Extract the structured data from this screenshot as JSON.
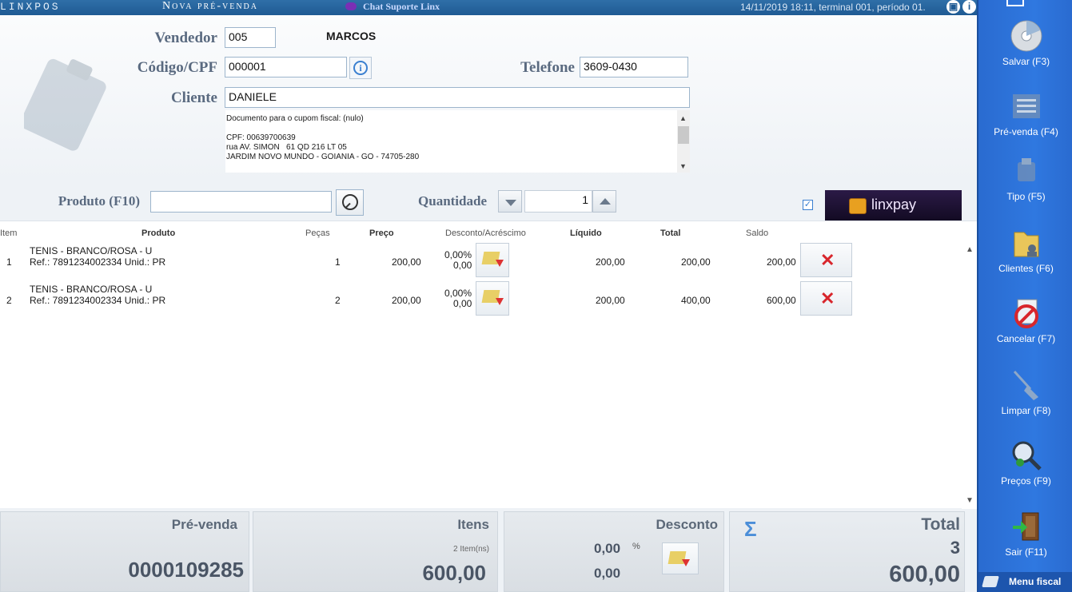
{
  "titlebar": {
    "brand": "LINXPOS",
    "screen": "Nova pré-venda",
    "chat": "Chat Suporte Linx",
    "status": "14/11/2019 18:11, terminal 001, período 01."
  },
  "form": {
    "vendedor_label": "Vendedor",
    "vendedor_code": "005",
    "vendedor_name": "MARCOS",
    "codigo_label": "Código/CPF",
    "codigo_value": "000001",
    "telefone_label": "Telefone",
    "telefone_value": "3609-0430",
    "cliente_label": "Cliente",
    "cliente_value": "DANIELE",
    "doc_lines": [
      "Documento para o cupom fiscal: (nulo)",
      "",
      "CPF: 00639700639",
      "rua AV. SIMON   61 QD 216 LT 05",
      "JARDIM NOVO MUNDO - GOIANIA - GO - 74705-280"
    ]
  },
  "product_bar": {
    "produto_label": "Produto (F10)",
    "produto_value": "",
    "quantidade_label": "Quantidade",
    "quantidade_value": "1",
    "linxpay_label": "linxpay"
  },
  "grid": {
    "headers": [
      "Item",
      "Produto",
      "Peças",
      "Preço",
      "Desconto/Acréscimo",
      "Líquido",
      "Total",
      "Saldo"
    ],
    "rows": [
      {
        "item": "1",
        "produto_l1": "TENIS  - BRANCO/ROSA - U",
        "produto_l2": "Ref.: 7891234002334 Unid.: PR",
        "pecas": "1",
        "preco": "200,00",
        "desc_pct": "0,00%",
        "desc_val": "0,00",
        "liquido": "200,00",
        "total": "200,00",
        "saldo": "200,00"
      },
      {
        "item": "2",
        "produto_l1": "TENIS  - BRANCO/ROSA - U",
        "produto_l2": "Ref.: 7891234002334 Unid.: PR",
        "pecas": "2",
        "preco": "200,00",
        "desc_pct": "0,00%",
        "desc_val": "0,00",
        "liquido": "200,00",
        "total": "400,00",
        "saldo": "600,00"
      }
    ]
  },
  "footer": {
    "prevenda_label": "Pré-venda",
    "prevenda_value": "0000109285",
    "itens_label": "Itens",
    "itens_count": "2 Item(ns)",
    "itens_value": "600,00",
    "desconto_label": "Desconto",
    "desconto_pct": "0,00",
    "desconto_pct_sign": "%",
    "desconto_value": "0,00",
    "total_label": "Total",
    "total_qty": "3",
    "total_value": "600,00"
  },
  "sidebar": {
    "items": [
      {
        "label": "Salvar (F3)",
        "icon": "disc-icon"
      },
      {
        "label": "Pré-venda (F4)",
        "icon": "prevenda-icon"
      },
      {
        "label": "Tipo (F5)",
        "icon": "tipo-icon"
      },
      {
        "label": "Clientes (F6)",
        "icon": "folder-clients-icon"
      },
      {
        "label": "Cancelar (F7)",
        "icon": "cancel-icon"
      },
      {
        "label": "Limpar (F8)",
        "icon": "broom-icon"
      },
      {
        "label": "Preços (F9)",
        "icon": "magnifier-icon"
      },
      {
        "label": "Sair (F11)",
        "icon": "exit-door-icon"
      }
    ],
    "menu_fiscal": "Menu fiscal"
  },
  "colors": {
    "sidebar": "#2f78e0",
    "titlebar": "#1f5a93",
    "delete": "#d8262c"
  }
}
